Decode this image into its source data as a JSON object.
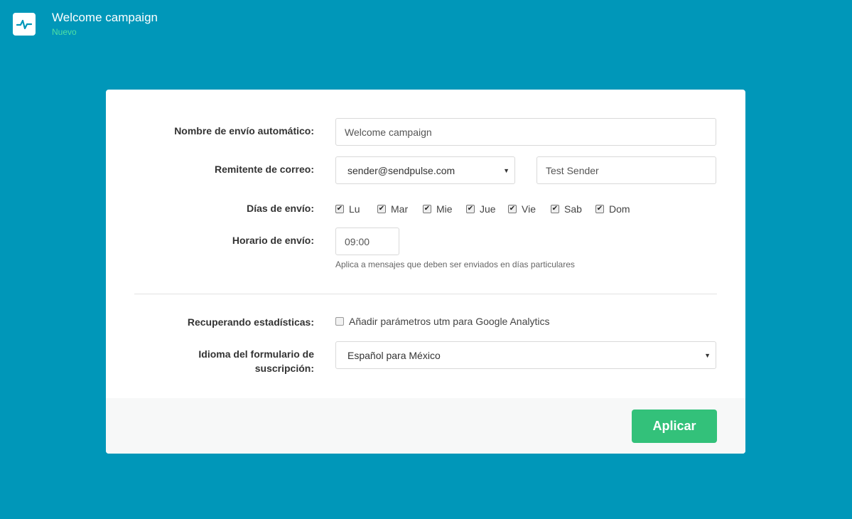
{
  "header": {
    "title": "Welcome campaign",
    "status": "Nuevo",
    "logo_icon": "pulse-icon"
  },
  "form": {
    "name": {
      "label": "Nombre de envío automático:",
      "value": "Welcome campaign"
    },
    "sender": {
      "label": "Remitente de correo:",
      "email": "sender@sendpulse.com",
      "name": "Test Sender"
    },
    "days": {
      "label": "Días de envío:",
      "items": [
        {
          "label": "Lu",
          "checked": true
        },
        {
          "label": "Mar",
          "checked": true
        },
        {
          "label": "Mie",
          "checked": true
        },
        {
          "label": "Jue",
          "checked": true
        },
        {
          "label": "Vie",
          "checked": true
        },
        {
          "label": "Sab",
          "checked": true
        },
        {
          "label": "Dom",
          "checked": true
        }
      ]
    },
    "time": {
      "label": "Horario de envío:",
      "value": "09:00",
      "hint": "Aplica a mensajes que deben ser enviados en días particulares"
    },
    "stats": {
      "label": "Recuperando estadísticas:",
      "checkbox_label": "Añadir parámetros utm para Google Analytics",
      "checked": false
    },
    "language": {
      "label_line1": "Idioma del formulario de",
      "label_line2": "suscripción:",
      "value": "Español para México"
    }
  },
  "footer": {
    "apply_label": "Aplicar"
  },
  "colors": {
    "background": "#0097b9",
    "accent": "#33c17a",
    "status": "#4fe0a4"
  }
}
